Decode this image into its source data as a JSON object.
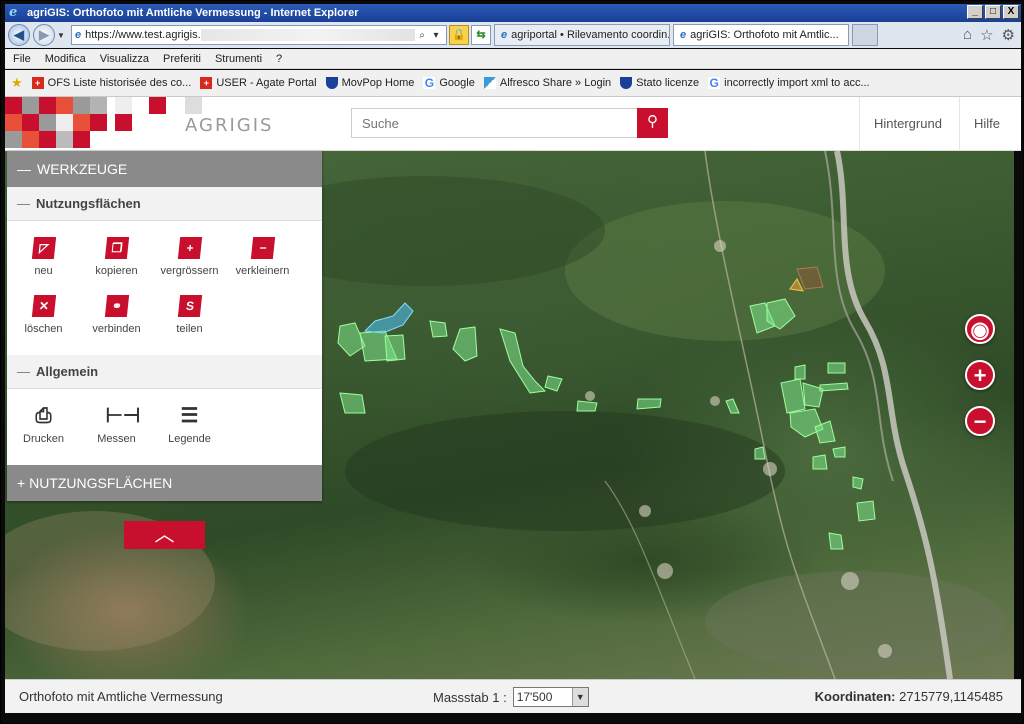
{
  "window": {
    "title": "agriGIS: Orthofoto mit Amtliche Vermessung - Internet Explorer",
    "buttons": [
      "_",
      "□",
      "X"
    ]
  },
  "navbar": {
    "url_prefix": "https://www.test.",
    "url_domain": "agrigis.",
    "tabs": [
      {
        "label": "agriportal • Rilevamento coordin..."
      },
      {
        "label": "agriGIS: Orthofoto mit Amtlic..."
      }
    ]
  },
  "menubar": {
    "items": [
      "File",
      "Modifica",
      "Visualizza",
      "Preferiti",
      "Strumenti",
      "?"
    ]
  },
  "favorites": {
    "items": [
      {
        "label": "OFS  Liste historisée des co...",
        "icon": "swiss-flag-icon"
      },
      {
        "label": "USER - Agate Portal",
        "icon": "swiss-flag-icon"
      },
      {
        "label": "MovPop Home",
        "icon": "shield-icon"
      },
      {
        "label": "Google",
        "icon": "google-icon"
      },
      {
        "label": "Alfresco Share » Login",
        "icon": "alfresco-icon"
      },
      {
        "label": "Stato licenze",
        "icon": "shield-icon"
      },
      {
        "label": "incorrectly import xml to acc...",
        "icon": "google-icon"
      }
    ]
  },
  "header": {
    "logo_text": "AGRIGIS",
    "search_placeholder": "Suche",
    "links": [
      "Hintergrund",
      "Hilfe"
    ],
    "brand_color": "#c8102e"
  },
  "panel": {
    "title": "WERKZEUGE",
    "sections": [
      {
        "title": "Nutzungsflächen",
        "tools": [
          {
            "label": "neu",
            "icon": "new-area-icon"
          },
          {
            "label": "kopieren",
            "icon": "copy-area-icon"
          },
          {
            "label": "vergrössern",
            "icon": "enlarge-area-icon"
          },
          {
            "label": "verkleinern",
            "icon": "shrink-area-icon"
          },
          {
            "label": "löschen",
            "icon": "delete-area-icon"
          },
          {
            "label": "verbinden",
            "icon": "merge-area-icon"
          },
          {
            "label": "teilen",
            "icon": "split-area-icon"
          }
        ]
      },
      {
        "title": "Allgemein",
        "tools": [
          {
            "label": "Drucken",
            "icon": "printer-icon"
          },
          {
            "label": "Messen",
            "icon": "ruler-icon"
          },
          {
            "label": "Legende",
            "icon": "list-icon"
          }
        ]
      }
    ],
    "footer": "NUTZUNGSFLÄCHEN"
  },
  "status": {
    "layer": "Orthofoto mit Amtliche Vermessung",
    "scale_label": "Massstab 1 :",
    "scale_value": "17'500",
    "coords_label": "Koordinaten:",
    "coords_value": "2715779,1145485"
  }
}
